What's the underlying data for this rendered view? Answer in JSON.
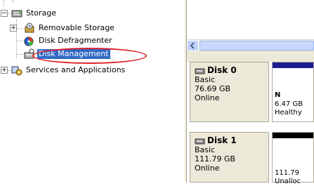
{
  "tree": {
    "items": [
      {
        "label": "Storage",
        "expander": "−"
      },
      {
        "label": "Removable Storage",
        "expander": "+"
      },
      {
        "label": "Disk Defragmenter"
      },
      {
        "label": "Disk Management",
        "selected": true
      },
      {
        "label": "Services and Applications",
        "expander": "+"
      }
    ]
  },
  "disks": [
    {
      "title": "Disk 0",
      "type": "Basic",
      "size": "76.69 GB",
      "status": "Online",
      "partition": {
        "name": "N",
        "size": "6.47 GB",
        "state": "Healthy"
      },
      "bar_color": "#1c1c8e"
    },
    {
      "title": "Disk 1",
      "type": "Basic",
      "size": "111.79 GB",
      "status": "Online",
      "partition": {
        "size": "111.79",
        "state": "Unalloc"
      },
      "bar_color": "#000000"
    }
  ],
  "colors": {
    "selection": "#316ac5",
    "highlight_oval": "#e0202a"
  }
}
